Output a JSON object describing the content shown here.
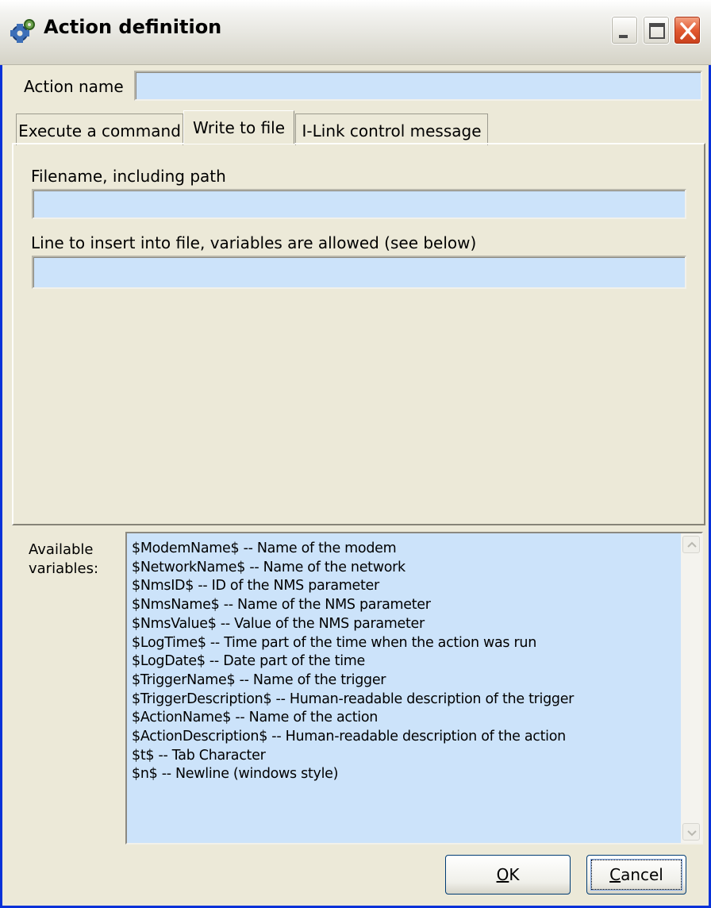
{
  "window": {
    "title": "Action definition",
    "app_icon": "gear-app-icon",
    "controls": [
      "minimize-icon",
      "maximize-icon",
      "close-icon"
    ]
  },
  "form": {
    "action_name_label": "Action name",
    "action_name_value": ""
  },
  "tabs": [
    {
      "label": "Execute a command",
      "active": false
    },
    {
      "label": "Write to file",
      "active": true
    },
    {
      "label": "I-Link control message",
      "active": false
    }
  ],
  "write_to_file": {
    "filename_label": "Filename, including path",
    "filename_value": "",
    "line_label": "Line to insert into file, variables are allowed (see below)",
    "line_value": ""
  },
  "variables": {
    "label_line1": "Available",
    "label_line2": "variables:",
    "items": [
      "$ModemName$ -- Name of the modem",
      "$NetworkName$ -- Name of the network",
      "$NmsID$ -- ID of the NMS parameter",
      "$NmsName$ -- Name of the NMS parameter",
      "$NmsValue$ -- Value of the NMS parameter",
      "$LogTime$ -- Time part of the time when the action was run",
      "$LogDate$ -- Date part of the time",
      "$TriggerName$ -- Name of the trigger",
      "$TriggerDescription$ -- Human-readable description of the trigger",
      "$ActionName$ -- Name of the action",
      "$ActionDescription$ -- Human-readable description of the action",
      "$t$ -- Tab Character",
      "$n$ -- Newline (windows style)"
    ]
  },
  "buttons": {
    "ok_mnemonic": "O",
    "ok_rest": "K",
    "cancel_mnemonic": "C",
    "cancel_rest": "ancel"
  },
  "colors": {
    "field_bg": "#cce3fa",
    "dialog_bg": "#ece9d8",
    "frame_border": "#0831d9"
  }
}
